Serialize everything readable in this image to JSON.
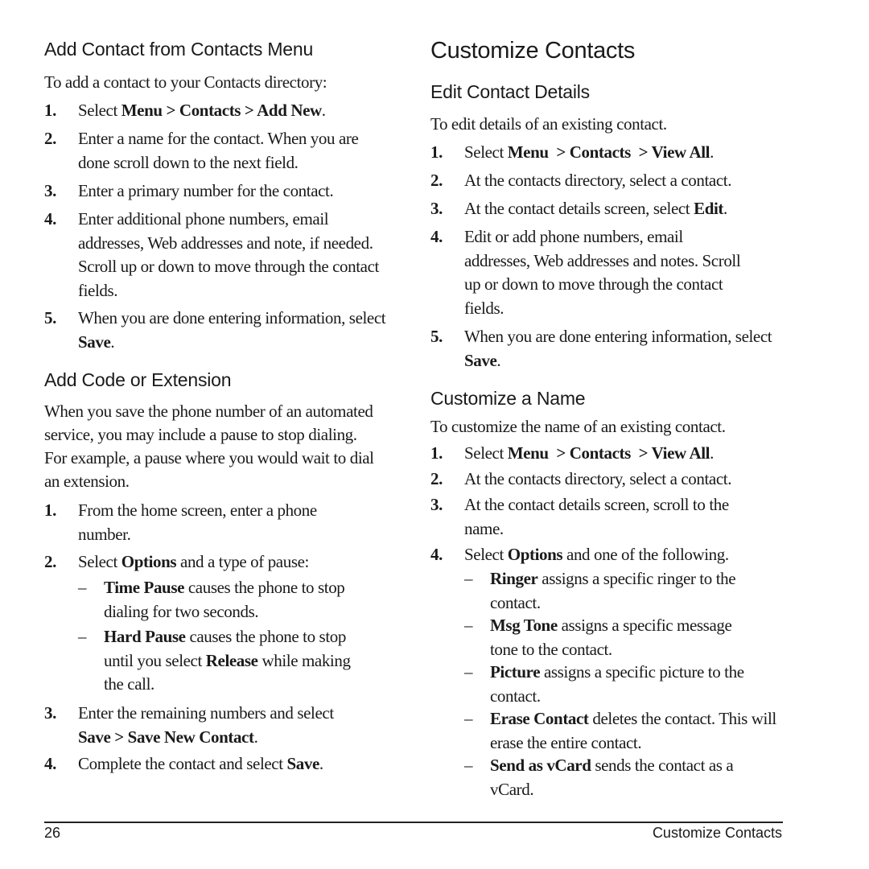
{
  "left": {
    "section1": {
      "heading": "Add Contact from Contacts Menu",
      "intro": "To add a contact to your Contacts directory:",
      "steps": [
        {
          "num": "1.",
          "pre": "Select ",
          "bold": "Menu > Contacts > Add New",
          "post": "."
        },
        {
          "num": "2.",
          "text": "Enter a name for the contact. When you are done scroll down to the next field."
        },
        {
          "num": "3.",
          "text": "Enter a primary number for the contact."
        },
        {
          "num": "4.",
          "text": "Enter additional phone numbers, email addresses, Web addresses and note, if needed. Scroll up or down to move through the contact fields."
        },
        {
          "num": "5.",
          "pre": "When you are done entering information, select ",
          "bold": "Save",
          "post": "."
        }
      ]
    },
    "section2": {
      "heading": "Add Code or Extension",
      "intro": "When you save the phone number of an automated service, you may include a pause to stop dialing. For example, a pause where you would wait to dial an extension.",
      "steps": [
        {
          "num": "1.",
          "text": "From the home screen, enter a phone number."
        },
        {
          "num": "2.",
          "pre": "Select ",
          "bold": "Options",
          "post": " and a type of pause:"
        },
        {
          "num": "3.",
          "pre": "Enter the remaining numbers and select ",
          "bold": "Save > Save New Contact",
          "post": "."
        },
        {
          "num": "4.",
          "pre": "Complete the contact and select ",
          "bold": "Save",
          "post": "."
        }
      ],
      "subitems": [
        {
          "dash": "–",
          "bold": "Time Pause",
          "post": " causes the phone to stop dialing for two seconds."
        },
        {
          "dash": "–",
          "bold": "Hard Pause",
          "mid": " causes the phone to stop until you select ",
          "bold2": "Release",
          "post": " while making the call."
        }
      ]
    }
  },
  "right": {
    "title": "Customize Contacts",
    "section1": {
      "heading": "Edit Contact Details",
      "intro": "To edit details of an existing contact.",
      "steps": [
        {
          "num": "1.",
          "pre": "Select ",
          "bold": "Menu  > Contacts  > View All",
          "post": "."
        },
        {
          "num": "2.",
          "text": "At the contacts directory, select a contact."
        },
        {
          "num": "3.",
          "pre": "At the contact details screen, select ",
          "bold": "Edit",
          "post": "."
        },
        {
          "num": "4.",
          "text": "Edit or add phone numbers, email addresses, Web addresses and notes. Scroll up or down to move through the contact fields."
        },
        {
          "num": "5.",
          "pre": "When you are done entering information, select ",
          "bold": "Save",
          "post": "."
        }
      ]
    },
    "section2": {
      "heading": "Customize a Name",
      "intro": "To customize the name of an existing contact.",
      "steps": [
        {
          "num": "1.",
          "pre": "Select ",
          "bold": "Menu  > Contacts  > View All",
          "post": "."
        },
        {
          "num": "2.",
          "text": "At the contacts directory, select a contact."
        },
        {
          "num": "3.",
          "text": "At the contact details screen, scroll to the name."
        },
        {
          "num": "4.",
          "pre": "Select ",
          "bold": "Options",
          "post": " and one of the following."
        }
      ],
      "subitems": [
        {
          "dash": "–",
          "bold": "Ringer",
          "post": " assigns a specific ringer to the contact."
        },
        {
          "dash": "–",
          "bold": "Msg Tone",
          "post": " assigns a specific message tone to the contact."
        },
        {
          "dash": "–",
          "bold": "Picture",
          "post": " assigns a specific picture to the contact."
        },
        {
          "dash": "–",
          "bold": "Erase Contact",
          "post": " deletes the contact. This will erase the entire contact."
        },
        {
          "dash": "–",
          "bold": "Send as vCard",
          "post": " sends the contact as a vCard."
        }
      ]
    }
  },
  "footer": {
    "page_number": "26",
    "section_title": "Customize Contacts"
  }
}
